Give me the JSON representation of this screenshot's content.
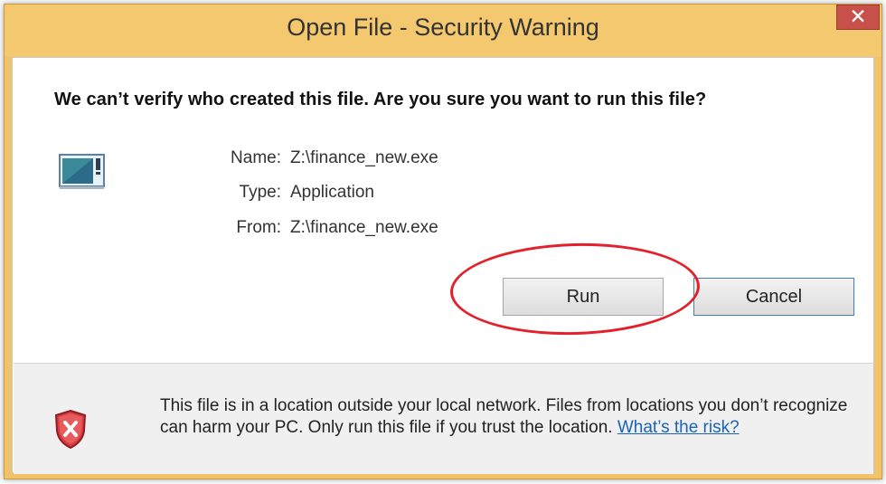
{
  "window": {
    "title": "Open File - Security Warning",
    "close_symbol": "✕"
  },
  "dialog": {
    "question": "We can’t verify who created this file. Are you sure you want to run this file?",
    "file_icon": "application-icon",
    "fields": [
      {
        "label": "Name:",
        "value": "Z:\\finance_new.exe"
      },
      {
        "label": "Type:",
        "value": "Application"
      },
      {
        "label": "From:",
        "value": "Z:\\finance_new.exe"
      }
    ],
    "buttons": {
      "run": "Run",
      "cancel": "Cancel"
    }
  },
  "footer": {
    "warning_icon": "shield-warning-icon",
    "message": "This file is in a location outside your local network. Files from locations you don’t recognize can harm your PC. Only run this file if you trust the location.",
    "risk_link": "What’s the risk?"
  },
  "annotation": {
    "highlight_color": "#e3202b"
  },
  "colors": {
    "titlebar": "#f4c86f",
    "close_button": "#c7504b",
    "link": "#1a63b8"
  }
}
